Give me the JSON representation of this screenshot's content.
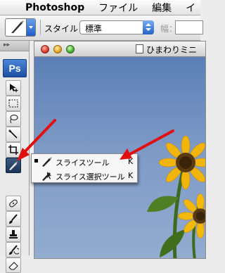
{
  "menubar": {
    "app_name": "Photoshop",
    "items": [
      "ファイル",
      "編集",
      "イ"
    ]
  },
  "options_bar": {
    "style_label": "スタイル：",
    "style_value": "標準",
    "width_label": "幅："
  },
  "palette": {
    "logo": "Ps"
  },
  "document": {
    "title": "ひまわりミニ"
  },
  "flyout": {
    "items": [
      {
        "label": "スライスツール",
        "shortcut": "K",
        "selected": true
      },
      {
        "label": "スライス選択ツール",
        "shortcut": "K",
        "selected": false
      }
    ]
  },
  "colors": {
    "annotation_arrow": "#e01010",
    "sky": "#7893bb",
    "sunflower": "#f1b40a"
  }
}
